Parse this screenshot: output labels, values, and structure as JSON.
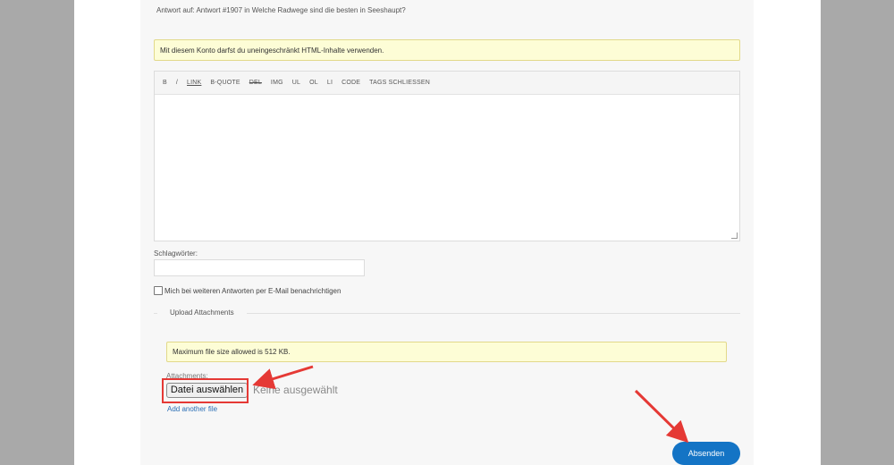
{
  "reply_to": "Antwort auf: Antwort #1907 in Welche Radwege sind die besten in Seeshaupt?",
  "html_notice": "Mit diesem Konto darfst du uneingeschränkt HTML-Inhalte verwenden.",
  "editor": {
    "toolbar": [
      {
        "label": "B",
        "name": "bold"
      },
      {
        "label": "/",
        "name": "italic"
      },
      {
        "label": "LINK",
        "name": "link"
      },
      {
        "label": "B-QUOTE",
        "name": "blockquote"
      },
      {
        "label": "DEL",
        "name": "del"
      },
      {
        "label": "IMG",
        "name": "img"
      },
      {
        "label": "UL",
        "name": "ul"
      },
      {
        "label": "OL",
        "name": "ol"
      },
      {
        "label": "LI",
        "name": "li"
      },
      {
        "label": "CODE",
        "name": "code"
      },
      {
        "label": "TAGS SCHLIESSEN",
        "name": "close-tags"
      }
    ],
    "content": ""
  },
  "tags": {
    "label": "Schlagwörter:",
    "value": ""
  },
  "notify": {
    "label": "Mich bei weiteren Antworten per E-Mail benachrichtigen",
    "checked": false
  },
  "upload": {
    "legend": "Upload Attachments",
    "max_size_notice": "Maximum file size allowed is 512 KB.",
    "attachments_label": "Attachments:",
    "choose_button": "Datei auswählen",
    "file_status": "Keine ausgewählt",
    "add_another": "Add another file"
  },
  "submit_label": "Absenden",
  "colors": {
    "accent": "#1474c5",
    "annotation": "#e53935",
    "notice_bg": "#fdfdd6"
  }
}
